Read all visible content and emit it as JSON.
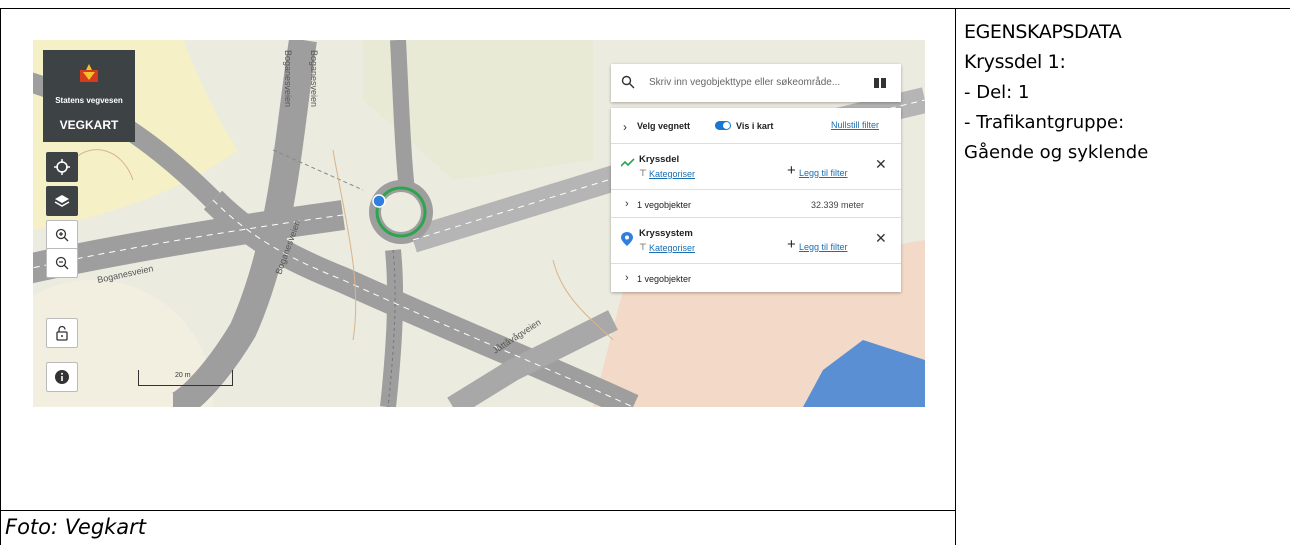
{
  "document": {
    "caption": "Foto: Vegkart",
    "properties": {
      "heading": "EGENSKAPSDATA",
      "subheading": "Kryssdel 1:",
      "lines": [
        "- Del: 1",
        "- Trafikantgruppe:",
        "Gående og syklende"
      ]
    }
  },
  "map": {
    "logo": {
      "org_name": "Statens vegvesen",
      "app_name": "VEGKART"
    },
    "controls": {
      "locate": "crosshair-icon",
      "layers": "layers-icon",
      "zoom_in": "zoom-in-icon",
      "zoom_out": "zoom-out-icon",
      "lock": "unlock-icon",
      "info": "info-icon"
    },
    "scale_label": "20 m",
    "road_labels": [
      "Boganesveien",
      "Boganesveien",
      "Boganesveien",
      "Boganesveien",
      "Jåttåvågveien"
    ],
    "search": {
      "placeholder": "Skriv inn vegobjekttype eller søkeområde..."
    },
    "filter_bar": {
      "select_network": "Velg vegnett",
      "show_in_map": "Vis i kart",
      "reset_filter": "Nullstill filter"
    },
    "objects": [
      {
        "title": "Kryssdel",
        "categorize": "Kategoriser",
        "add_filter": "Legg til filter",
        "count": "1 vegobjekter",
        "length": "32.339 meter",
        "icon": "line-chart-icon"
      },
      {
        "title": "Kryssystem",
        "categorize": "Kategoriser",
        "add_filter": "Legg til filter",
        "count": "1 vegobjekter",
        "icon": "map-pin-icon"
      }
    ],
    "colors": {
      "panel_dark": "#3d4245",
      "link": "#1a6fb3",
      "toggle": "#1976d2",
      "roundabout_highlight": "#2ea44f",
      "marker": "#2f7fe0"
    }
  }
}
